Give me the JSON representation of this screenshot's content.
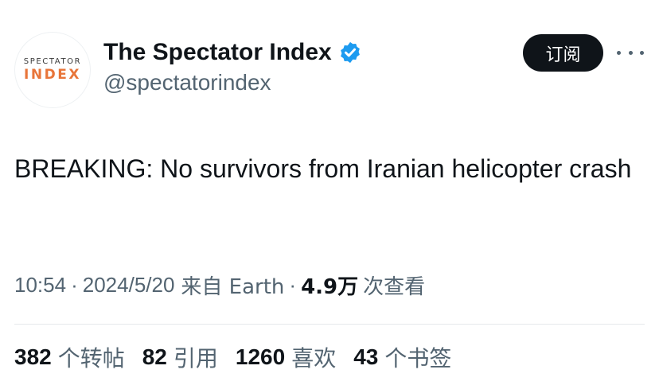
{
  "author": {
    "avatar_top": "SPECTATOR",
    "avatar_bottom": "INDEX",
    "display_name": "The Spectator Index",
    "handle": "@spectatorindex",
    "verified_color": "#1d9bf0"
  },
  "actions": {
    "subscribe_label": "订阅",
    "more_icon": "more-horizontal-icon"
  },
  "tweet": {
    "text": "BREAKING: No survivors from Iranian helicopter crash"
  },
  "meta": {
    "time": "10:54",
    "separator": "·",
    "date": "2024/5/20",
    "source": "来自 Earth",
    "views_count": "4.9万",
    "views_label": "次查看"
  },
  "stats": [
    {
      "count": "382",
      "label": "个转帖"
    },
    {
      "count": "82",
      "label": "引用"
    },
    {
      "count": "1260",
      "label": "喜欢"
    },
    {
      "count": "43",
      "label": "个书签"
    }
  ]
}
